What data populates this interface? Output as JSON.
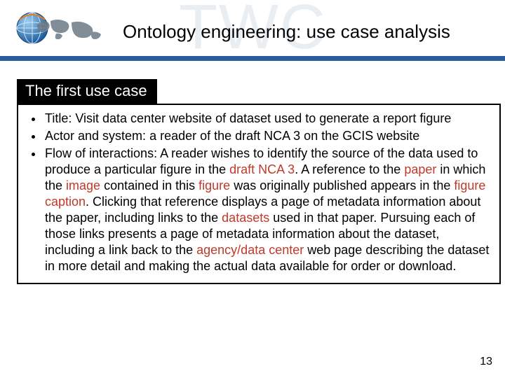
{
  "watermark": "TWC",
  "header": {
    "title": "Ontology engineering: use case analysis"
  },
  "section": {
    "heading": "The first use case"
  },
  "bullets": {
    "b1": {
      "prefix": "Title: ",
      "rest": "Visit data center website of dataset used to generate a report figure"
    },
    "b2": {
      "prefix": "Actor and system: ",
      "rest": "a reader of the draft NCA 3 on the GCIS website"
    },
    "b3": {
      "prefix": "Flow of interactions: ",
      "p1": "A reader wishes to identify the source of the data used to produce a particular figure in the ",
      "h1": "draft NCA 3",
      "p2": ". A reference to the ",
      "h2": "paper",
      "p3": " in which the ",
      "h3": "image",
      "p4": " contained in this ",
      "h4": "figure",
      "p5": " was originally published appears in the ",
      "h5": "figure caption",
      "p6": ". Clicking that reference displays a page of metadata information about the paper, including links to the ",
      "h6": "datasets",
      "p7": " used in that paper. Pursuing each of those links presents a page of metadata information about the dataset, including a link back to the ",
      "h7": "agency/data center",
      "p8": " web page describing the dataset in more detail and making the actual data available for order or download."
    }
  },
  "page_number": "13"
}
